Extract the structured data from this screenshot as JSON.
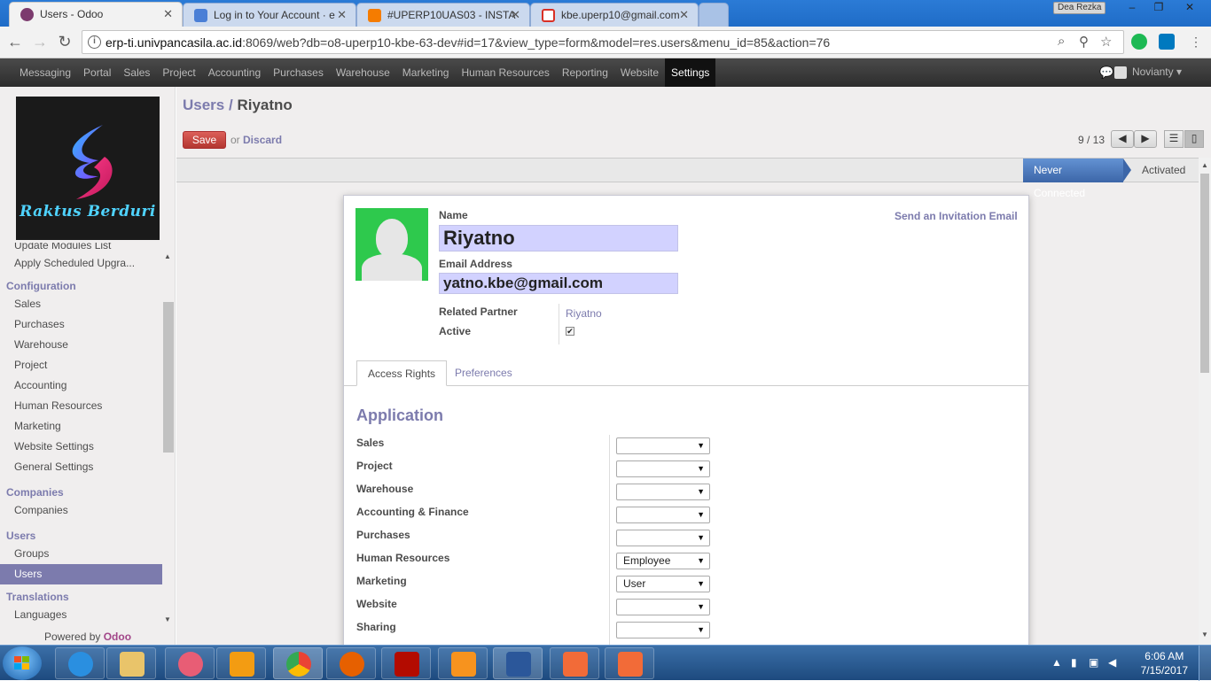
{
  "browser": {
    "tabs": [
      {
        "title": "Users - Odoo",
        "color": "#7c3b6e",
        "active": true
      },
      {
        "title": "Log in to Your Account · e",
        "color": "#4a7fd6",
        "active": false
      },
      {
        "title": "#UPERP10UAS03 - INSTA",
        "color": "#f57c00",
        "active": false
      },
      {
        "title": "kbe.uperp10@gmail.com",
        "color": "#d93025",
        "active": false
      }
    ],
    "window_user": "Dea Rezka",
    "url_host": "erp-ti.univpancasila.ac.id",
    "url_rest": ":8069/web?db=o8-uperp10-kbe-63-dev#id=17&view_type=form&model=res.users&menu_id=85&action=76"
  },
  "topbar": {
    "menu": [
      "Messaging",
      "Portal",
      "Sales",
      "Project",
      "Accounting",
      "Purchases",
      "Warehouse",
      "Marketing",
      "Human Resources",
      "Reporting",
      "Website",
      "Settings"
    ],
    "active_menu": "Settings",
    "user_name": "Novianty"
  },
  "sidebar": {
    "logo_text": "Raktus Berduri",
    "partial_item": "Update Modules List",
    "scheduled": "Apply Scheduled Upgra...",
    "sections": [
      {
        "title": "Configuration",
        "items": [
          "Sales",
          "Purchases",
          "Warehouse",
          "Project",
          "Accounting",
          "Human Resources",
          "Marketing",
          "Website Settings",
          "General Settings"
        ]
      },
      {
        "title": "Companies",
        "items": [
          "Companies"
        ]
      },
      {
        "title": "Users",
        "items": [
          "Groups",
          "Users"
        ]
      },
      {
        "title": "Translations",
        "items": [
          "Languages"
        ]
      }
    ],
    "active_item": "Users",
    "powered_by": "Powered by",
    "powered_brand": "Odoo"
  },
  "form": {
    "breadcrumb_parent": "Users",
    "breadcrumb_sep": " / ",
    "breadcrumb_current": "Riyatno",
    "save_label": "Save",
    "or_label": "or",
    "discard_label": "Discard",
    "pager": "9 / 13",
    "status_active": "Never Connected",
    "status_next": "Activated",
    "name_label": "Name",
    "name_value": "Riyatno",
    "email_label": "Email Address",
    "email_value": "yatno.kbe@gmail.com",
    "invite_label": "Send an Invitation Email",
    "related_partner_label": "Related Partner",
    "related_partner_value": "Riyatno",
    "active_label": "Active",
    "active_checked": true,
    "tab_access": "Access Rights",
    "tab_prefs": "Preferences",
    "application_title": "Application",
    "applications": [
      {
        "label": "Sales",
        "value": ""
      },
      {
        "label": "Project",
        "value": ""
      },
      {
        "label": "Warehouse",
        "value": ""
      },
      {
        "label": "Accounting & Finance",
        "value": ""
      },
      {
        "label": "Purchases",
        "value": ""
      },
      {
        "label": "Human Resources",
        "value": "Employee"
      },
      {
        "label": "Marketing",
        "value": "User"
      },
      {
        "label": "Website",
        "value": ""
      },
      {
        "label": "Sharing",
        "value": ""
      }
    ]
  },
  "taskbar": {
    "time": "6:06 AM",
    "date": "7/15/2017",
    "apps": [
      {
        "name": "internet-explorer",
        "color": "#2a8fe0"
      },
      {
        "name": "file-explorer",
        "color": "#e9c46a"
      },
      {
        "name": "snipping-tool",
        "color": "#e85d75"
      },
      {
        "name": "media-player",
        "color": "#f39c12"
      },
      {
        "name": "chrome",
        "color": "#34a853"
      },
      {
        "name": "firefox",
        "color": "#e66000"
      },
      {
        "name": "acrobat",
        "color": "#b30b00"
      },
      {
        "name": "package-app",
        "color": "#f7931e"
      },
      {
        "name": "word",
        "color": "#2b579a"
      },
      {
        "name": "photo-app",
        "color": "#f26b38"
      },
      {
        "name": "camera-app",
        "color": "#f26b38"
      }
    ]
  }
}
